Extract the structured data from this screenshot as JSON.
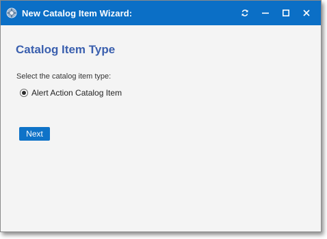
{
  "window": {
    "title": "New Catalog Item Wizard:",
    "controls": {
      "refresh_icon": "refresh-icon",
      "minimize_icon": "minimize-icon",
      "maximize_icon": "maximize-icon",
      "close_icon": "close-icon"
    }
  },
  "page": {
    "heading": "Catalog Item Type",
    "prompt": "Select the catalog item type:",
    "options": [
      {
        "label": "Alert Action Catalog Item",
        "selected": true
      }
    ],
    "next_label": "Next"
  },
  "colors": {
    "titlebar": "#0b6fc6",
    "heading": "#3a5fae",
    "button": "#0f73c8",
    "background": "#f4f4f4"
  }
}
